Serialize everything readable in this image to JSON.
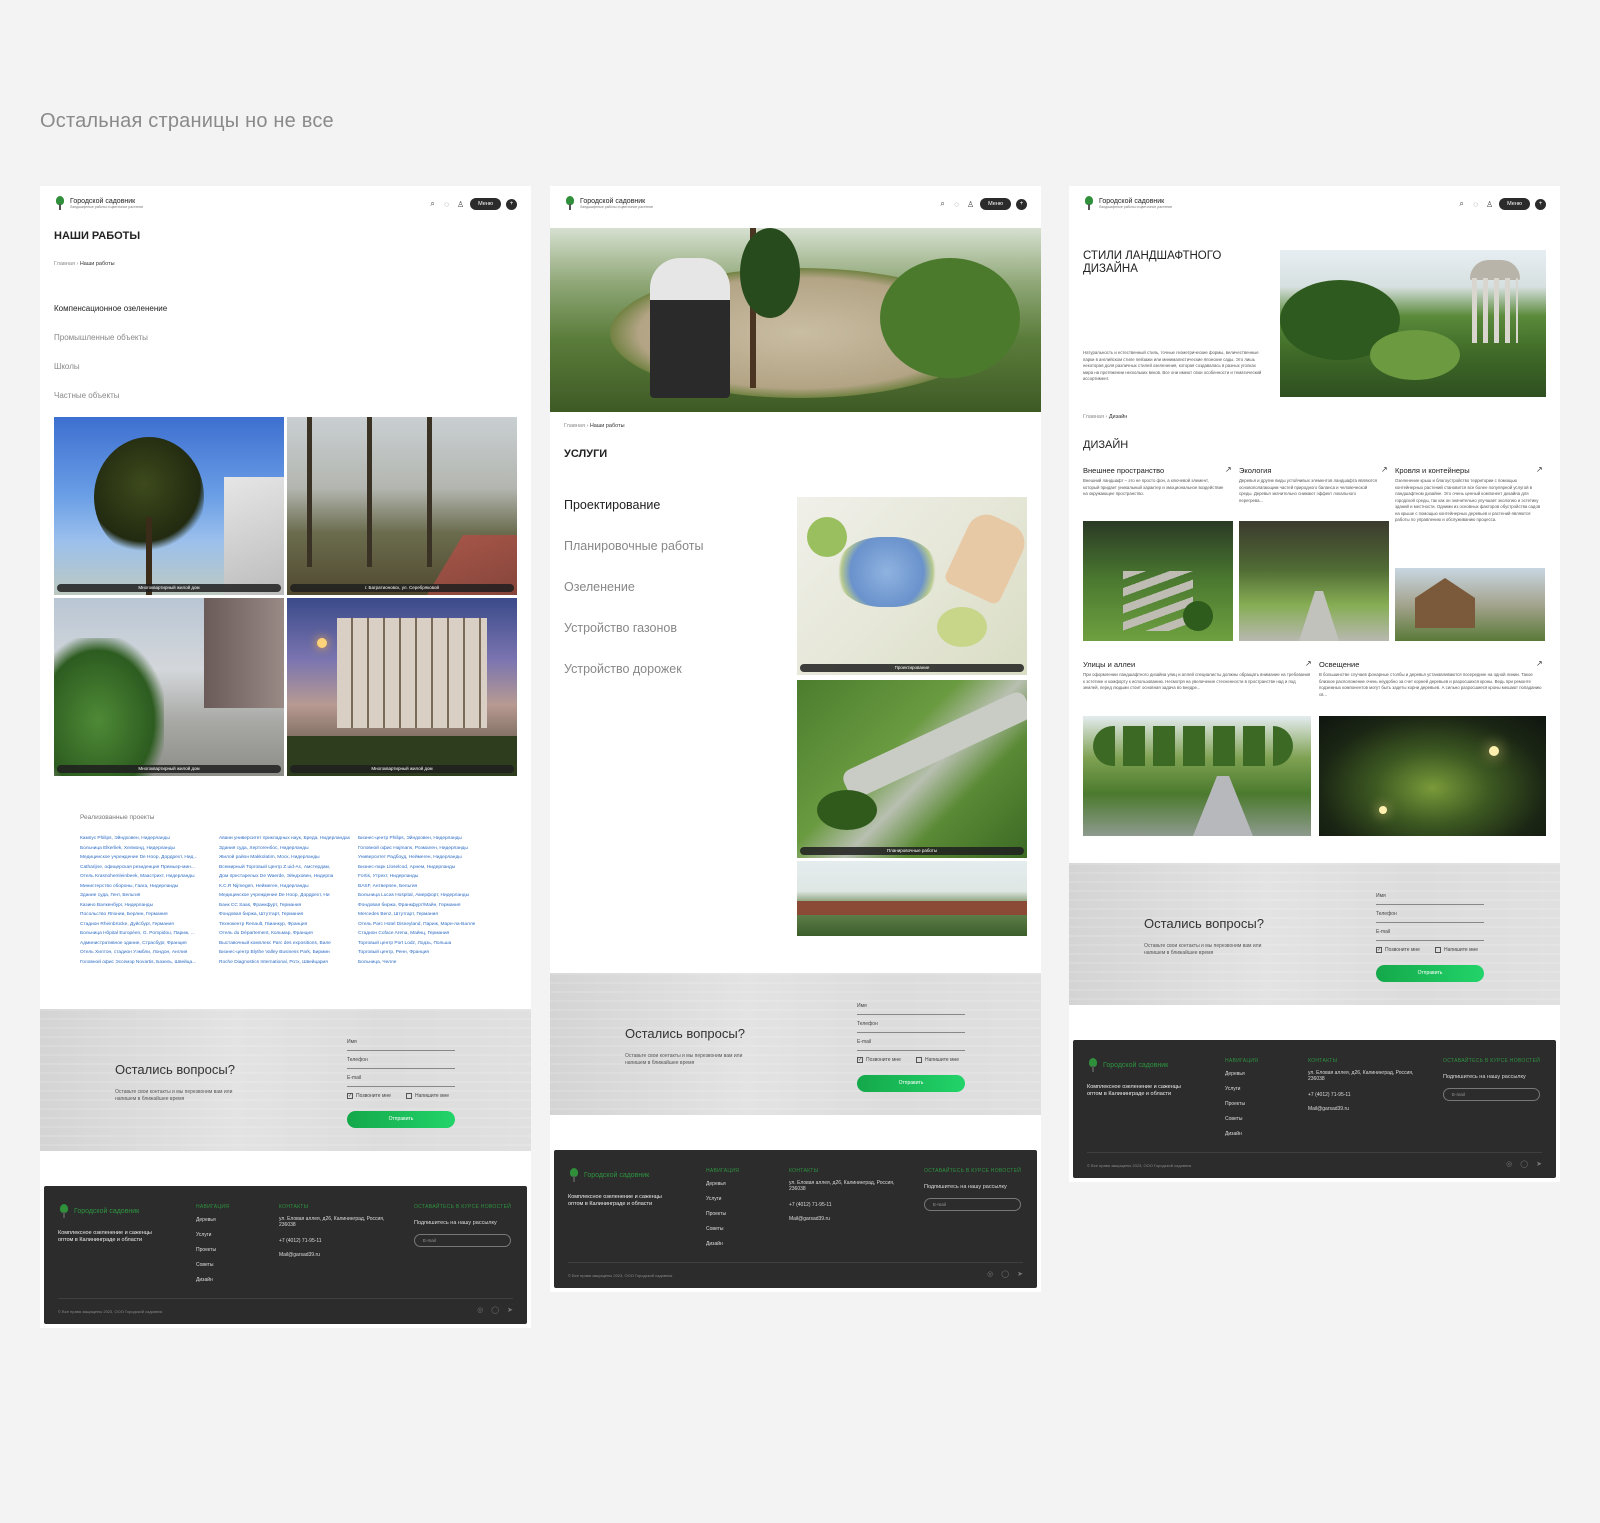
{
  "page_heading": "Остальная страницы но не все",
  "header": {
    "logo_title": "Городской садовник",
    "logo_subtitle": "Ландшафтные работы и цветочное растение",
    "menu_label": "Меню",
    "icons": [
      "search-icon",
      "cart-icon",
      "user-icon"
    ]
  },
  "works": {
    "title": "НАШИ РАБОТЫ",
    "crumb_home": "Главная",
    "crumb_current": "Наши работы",
    "categories": [
      "Компенсационное озеленение",
      "Промышленные объекты",
      "Школы",
      "Частные объекты"
    ],
    "photo_captions": [
      "Многоквартирный жилой дом",
      "г. Багратионовск, ул. Серебряковой",
      "Многоквартирный жилой дом",
      "Многоквартирный жилой дом"
    ],
    "projects_title": "Реализованные проекты",
    "projects_col1": [
      "Кампус Philips, Эйндховен, Нидерланды",
      "Больница Elkerliek, Хелмонд, Нидерланды",
      "Медицинское учреждение De Hoop, Дордрехт, Нид...",
      "Catharijne, офицерская резиденция Премьер-мин...",
      "Отель Krasnohemleinbeek, Маастрихт, Нидерланды",
      "Министерство обороны, Гаага, Нидерланды",
      "Здание суда, Гент, Бельгия",
      "Казино Валкенбург, Нидерланды",
      "Посольство Японии, Берлин, Германия",
      "Стадион Rheinbrücke, Дуйсбург, Германия",
      "Больница Hôpital Européen, G. Pompidou, Париж, ...",
      "Административное здание, Страсбург, Франция",
      "Отель Хилтон, стадион Уэмбли, Лондон, Англия",
      "Головной офис Эссемэр Novartis, Базель, Швейца..."
    ],
    "projects_col2": [
      "Авани университет прикладных наук, Бреда, Нидерландах",
      "Здания суда, Хертогенбос, Нидерланды",
      "Жилой район Makkolatim, Моск, Нидерланды",
      "Всемирный Торговый Центр Z.uid-Ас, Амстердам,",
      "Дом престарелых De Waerde, Эйндховен, Нидерла",
      "К.С.R Nijmegen, Неймеген, Нидерланды",
      "Медицинское учреждение De Hoop, Дордрехт, Ни",
      "Банк СС Saas, Франкфурт, Германия",
      "Фондовая биржа, Штутгарт, Германия",
      "Технокентр Renault, Гвианкур, Франция",
      "Отель du Département, Кольмар, Франция",
      "Выставочный комплекс Parc des expositions, Вале",
      "Бизнес-центр Blythe Valley Business Park, Бирмин",
      "Roche Diagnostics International, Ротх, Швейцария"
    ],
    "projects_col3": [
      "Бизнес-центр Philips, Эйндховен, Нидерланды",
      "Головной офис Hajmans, Розмален, Нидерланды",
      "Университет Радбоуд, Неймеген, Нидерланды",
      "Бизнес-парк Lloselcod, Арнем, Нидерланды",
      "Fortis, Утрехт, Нидерланды",
      "BASF, Антверпен, Бельгия",
      "Больница Lucas Hospital, Амерфорт, Нидерланды",
      "Фондовая биржа, Франкфурт/Майн, Германия",
      "Mercedes Benz, Штутгарт, Германия",
      "Отель Parc Hotel Disneyland, Париж, Марн-ла-Валле",
      "Стадион Coface Arena, Майнц, Германия",
      "Торговый центр Port Lodz, Лодзь, Польша",
      "Торговый центр, Ренн, Франция",
      "Больница, Челле"
    ]
  },
  "services": {
    "crumb_home": "Главная",
    "crumb_current": "Наши работы",
    "title": "УСЛУГИ",
    "items": [
      "Проектирование",
      "Планировочные работы",
      "Озеленение",
      "Устройство газонов",
      "Устройство дорожек"
    ],
    "photo_captions": [
      "Проектирование",
      "Планировочные работы"
    ]
  },
  "design": {
    "hero_title": "СТИЛИ ЛАНДШАФТНОГО ДИЗАЙНА",
    "hero_text": "Натуральность и естественный стиль, точные геометрические формы, величественные парки в английском стиле пейзажи или минималистические японские сады. Это лишь некоторая доля различных стилей озеленения, которая создавалась в разных уголках мира на протяжении нескольких веков. Все они имеют свои особенности и тематический ассортимент.",
    "crumb_home": "Главная",
    "crumb_current": "Дизайн",
    "title": "ДИЗАЙН",
    "sections": [
      {
        "title": "Внешнее пространство",
        "text": "Внешний ландшафт – это не просто фон, а ключевой элемент, который придает уникальный характер и эмоциональное воздействие на окружающее пространство."
      },
      {
        "title": "Экология",
        "text": "Деревья и другие виды устойчивых элементов ландшафта являются основополагающим частей природного баланса и человеческой среды. Деревья значительно снижают эффект локального перегрева..."
      },
      {
        "title": "Кровля и контейнеры",
        "text": "Озеленение крыш и благоустройство территории с помощью контейнерных растений становится все более популярной услугой в ландшафтном дизайне. Это очень ценный компонент дизайна для городской среды, так как он значительно улучшает экологию и эстетику зданий и местности. Одними из основных факторов обустройства садов на крыше с помощью контейнерных деревьев и растений являются работы по управлению и обслуживанию процесса."
      },
      {
        "title": "Улицы и аллеи",
        "text": "При оформлении ландшафтного дизайна улиц и аллей специалисты должны обращать внимание на требования к эстетике и комфорту к использованию. Несмотря на увеличение стесненности в пространстве над и под землей, перед людьми стоит основная задача во внедре..."
      },
      {
        "title": "Освещение",
        "text": "В большинстве случаев фонарные столбы и деревья устанавливаются посередине на одной линии. Такое близкое расположение очень неудобно за счет корней деревьев и разросшихся кроны. Ведь при ремонте подземных компонентов могут быть задеты корни деревьев. А сильно разросшиеся кроны мешают попаданию св..."
      }
    ]
  },
  "contact_form": {
    "title": "Остались вопросы?",
    "text": "Оставьте свои контакты и мы перезвоним вам или напишем в ближайшее время",
    "name_label": "Имя",
    "phone_label": "Телефон",
    "email_label": "E-mail",
    "call_me": "Позвоните мне",
    "write_me": "Напишите мне",
    "submit": "Отправить"
  },
  "footer": {
    "brand": "Городской садовник",
    "description": "Комплексное озеленение и саженцы оптом в Калининграде и области",
    "nav_heading": "НАВИГАЦИЯ",
    "nav_items": [
      "Деревья",
      "Услуги",
      "Проекты",
      "Советы",
      "Дизайн"
    ],
    "contacts_heading": "КОНТАКТЫ",
    "address": "ул. Еловая аллея, д26, Калининград, Россия, 236038",
    "phone": "+7 (4012) 71-95-11",
    "email": "Mail@garsad39.ru",
    "news_heading": "ОСТАВАЙТЕСЬ В КУРСЕ НОВОСТЕЙ",
    "subscribe": "Подпишитесь на нашу рассылку",
    "email_placeholder": "E-mail",
    "copyright": "© Все права защищены 2023, ООО Городской садовник"
  },
  "colors": {
    "accent": "#1fc35f",
    "footer_bg": "#2c2c2c",
    "brand_green": "#2e9440",
    "link_blue": "#2d6bc4"
  }
}
